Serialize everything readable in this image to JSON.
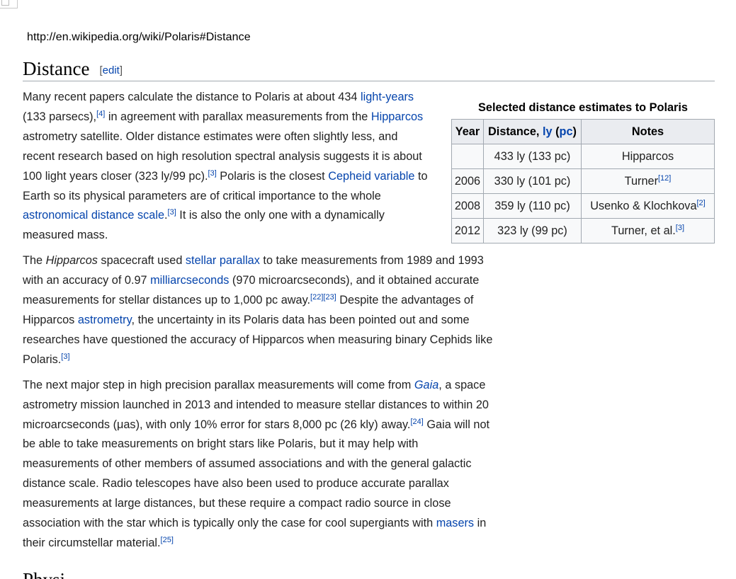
{
  "url": "http://en.wikipedia.org/wiki/Polaris#Distance",
  "section": {
    "title": "Distance",
    "edit_label": "edit",
    "bracket_open": "[",
    "bracket_close": "]"
  },
  "table": {
    "caption": "Selected distance estimates to Polaris",
    "headers": {
      "year": "Year",
      "distance_prefix": "Distance, ",
      "distance_ly": "ly",
      "distance_open": " (",
      "distance_pc": "pc",
      "distance_close": ")",
      "notes": "Notes"
    },
    "rows": [
      {
        "year": "",
        "distance": "433 ly (133 pc)",
        "notes": "Hipparcos",
        "ref": ""
      },
      {
        "year": "2006",
        "distance": "330 ly (101 pc)",
        "notes": "Turner",
        "ref": "[12]"
      },
      {
        "year": "2008",
        "distance": "359 ly (110 pc)",
        "notes": "Usenko & Klochkova",
        "ref": "[2]"
      },
      {
        "year": "2012",
        "distance": "323 ly (99 pc)",
        "notes": "Turner, et al.",
        "ref": "[3]"
      }
    ]
  },
  "p1": {
    "t1": "Many recent papers calculate the distance to Polaris at about 434 ",
    "l1": "light-years",
    "t2": " (133 parsecs),",
    "r1": "[4]",
    "t3": " in agreement with parallax measurements from the ",
    "l2": "Hipparcos",
    "t4": " astrometry satellite. Older distance estimates were often slightly less, and recent research based on high resolution spectral analysis suggests it is about 100 light years closer (323 ly/99 pc).",
    "r2": "[3]",
    "t5": " Polaris is the closest ",
    "l3": "Cepheid variable",
    "t6": " to Earth so its physical parameters are of critical importance to the whole ",
    "l4": "astronomical distance scale",
    "t7": ".",
    "r3": "[3]",
    "t8": " It is also the only one with a dynamically measured mass."
  },
  "p2": {
    "t1": "The ",
    "i1": "Hipparcos",
    "t2": " spacecraft used ",
    "l1": "stellar parallax",
    "t3": " to take measurements from 1989 and 1993 with an accuracy of 0.97 ",
    "l2": "milliarcseconds",
    "t4": " (970 microarcseconds), and it obtained accurate measurements for stellar distances up to 1,000 pc away.",
    "r1": "[22]",
    "r2": "[23]",
    "t5": " Despite the advantages of Hipparcos ",
    "l3": "astrometry",
    "t6": ", the uncertainty in its Polaris data has been pointed out and some researches have questioned the accuracy of Hipparcos when measuring binary Cephids like Polaris.",
    "r3": "[3]"
  },
  "p3": {
    "t1": "The next major step in high precision parallax measurements will come from ",
    "l1": "Gaia",
    "t2": ", a space astrometry mission launched in 2013 and intended to measure stellar distances to within 20 microarcseconds (μas), with only 10% error for stars 8,000 pc (26 kly) away.",
    "r1": "[24]",
    "t3": " Gaia will not be able to take measurements on bright stars like Polaris, but it may help with measurements of other members of assumed associations and with the general galactic distance scale. Radio telescopes have also been used to produce accurate parallax measurements at large distances, but these require a compact radio source in close association with the star which is typically only the case for cool supergiants with ",
    "l2": "masers",
    "t4": " in their circumstellar material.",
    "r2": "[25]"
  },
  "next_heading": "Physical"
}
